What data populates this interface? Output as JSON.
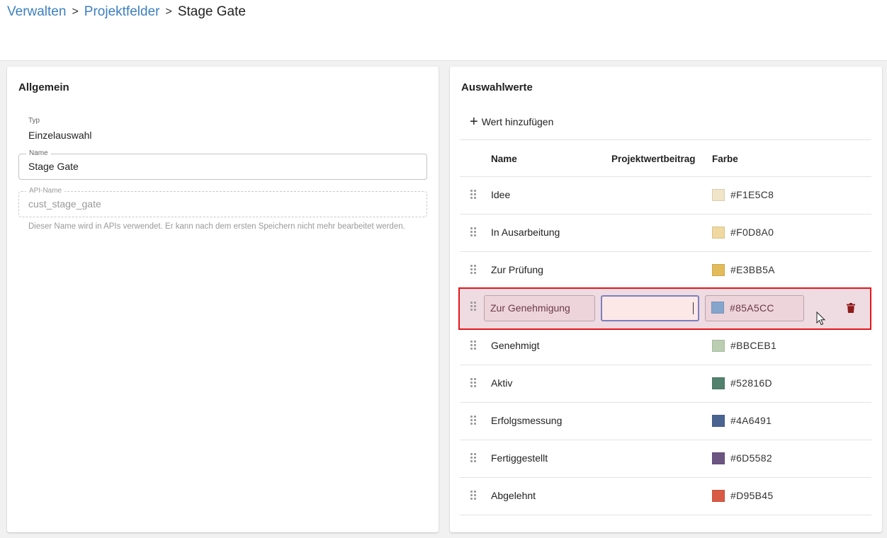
{
  "breadcrumb": {
    "items": [
      "Verwalten",
      "Projektfelder"
    ],
    "separator": ">",
    "current": "Stage Gate"
  },
  "allgemein": {
    "title": "Allgemein",
    "typ_label": "Typ",
    "typ_value": "Einzelauswahl",
    "name_label": "Name",
    "name_value": "Stage Gate",
    "api_label": "API-Name",
    "api_value": "cust_stage_gate",
    "api_help": "Dieser Name wird in APIs verwendet. Er kann nach dem ersten Speichern nicht mehr bearbeitet werden."
  },
  "auswahlwerte": {
    "title": "Auswahlwerte",
    "add_label": "Wert hinzufügen",
    "headers": {
      "name": "Name",
      "beitrag": "Projektwertbeitrag",
      "farbe": "Farbe"
    },
    "rows": [
      {
        "name": "Idee",
        "beitrag": "",
        "color": "#F1E5C8"
      },
      {
        "name": "In Ausarbeitung",
        "beitrag": "",
        "color": "#F0D8A0"
      },
      {
        "name": "Zur Prüfung",
        "beitrag": "",
        "color": "#E3BB5A"
      },
      {
        "name": "Zur Genehmigung",
        "beitrag": "",
        "color": "#85A5CC",
        "editing": true
      },
      {
        "name": "Genehmigt",
        "beitrag": "",
        "color": "#BBCEB1"
      },
      {
        "name": "Aktiv",
        "beitrag": "",
        "color": "#52816D"
      },
      {
        "name": "Erfolgsmessung",
        "beitrag": "",
        "color": "#4A6491"
      },
      {
        "name": "Fertiggestellt",
        "beitrag": "",
        "color": "#6D5582"
      },
      {
        "name": "Abgelehnt",
        "beitrag": "",
        "color": "#D95B45"
      }
    ]
  },
  "icons": {
    "add": "plus-icon",
    "drag": "drag-handle-icon",
    "delete": "trash-icon",
    "cursor": "mouse-pointer-icon"
  },
  "theme": {
    "link": "#3D7FBF",
    "highlight_border": "#E4161C",
    "edit_row_bg": "#EFDCE2",
    "delete_icon": "#8E1B1B"
  }
}
